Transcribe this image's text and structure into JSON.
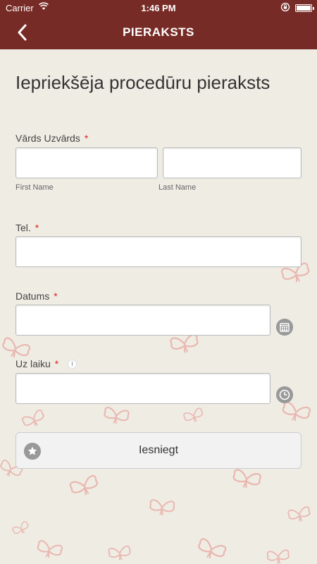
{
  "status_bar": {
    "carrier": "Carrier",
    "time": "1:46 PM"
  },
  "nav": {
    "title": "PIERAKSTS",
    "back_icon": "chevron-left-icon"
  },
  "form": {
    "heading": "Iepriekšēja procedūru pieraksts",
    "name": {
      "label": "Vārds Uzvārds",
      "required_mark": "*",
      "first_value": "",
      "last_value": "",
      "first_sublabel": "First Name",
      "last_sublabel": "Last Name"
    },
    "phone": {
      "label": "Tel.",
      "required_mark": "*",
      "value": ""
    },
    "date": {
      "label": "Datums",
      "required_mark": "*",
      "value": "",
      "icon": "calendar-icon"
    },
    "time": {
      "label": "Uz laiku",
      "required_mark": "*",
      "value": "",
      "info_icon": "info-icon",
      "icon": "clock-icon"
    },
    "submit": {
      "label": "Iesniegt",
      "icon": "star-icon"
    }
  },
  "colors": {
    "header": "#772b26",
    "background": "#efece4",
    "required": "#d22222",
    "icon_gray": "#999999"
  }
}
